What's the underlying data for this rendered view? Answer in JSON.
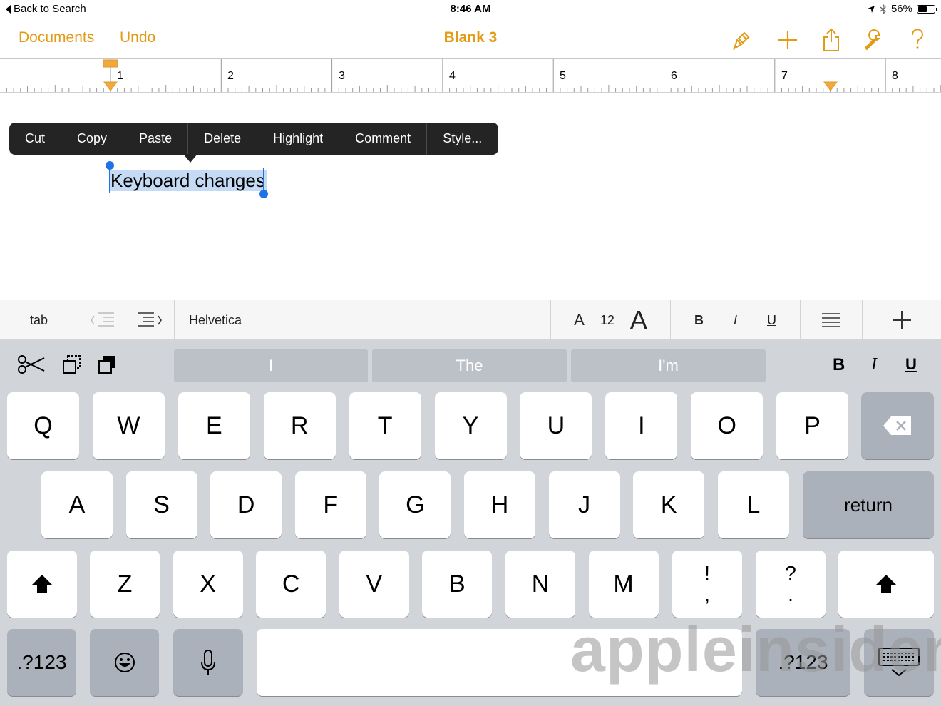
{
  "status": {
    "back_label": "Back to Search",
    "time": "8:46 AM",
    "battery_text": "56%",
    "battery_level": 0.56
  },
  "nav": {
    "documents": "Documents",
    "undo": "Undo",
    "title": "Blank 3",
    "icons": [
      "paintbrush-icon",
      "plus-icon",
      "share-icon",
      "wrench-icon",
      "help-icon"
    ]
  },
  "ruler": {
    "numbers": [
      "1",
      "2",
      "3",
      "4",
      "5",
      "6",
      "7",
      "8"
    ]
  },
  "edit_menu": {
    "items": [
      "Cut",
      "Copy",
      "Paste",
      "Delete",
      "Highlight",
      "Comment",
      "Style..."
    ]
  },
  "document": {
    "selected_text": "Keyboard changes"
  },
  "format_bar": {
    "tab": "tab",
    "font": "Helvetica",
    "font_size": "12",
    "small_a": "A",
    "large_a": "A",
    "bold": "B",
    "italic": "I",
    "underline": "U"
  },
  "keyboard": {
    "suggestions": [
      "I",
      "The",
      "I'm"
    ],
    "shortcut_bold": "B",
    "shortcut_italic": "I",
    "shortcut_underline": "U",
    "row1": [
      "Q",
      "W",
      "E",
      "R",
      "T",
      "Y",
      "U",
      "I",
      "O",
      "P"
    ],
    "row2": [
      "A",
      "S",
      "D",
      "F",
      "G",
      "H",
      "J",
      "K",
      "L"
    ],
    "row3": [
      "Z",
      "X",
      "C",
      "V",
      "B",
      "N",
      "M"
    ],
    "punct1_top": "!",
    "punct1_bottom": ",",
    "punct2_top": "?",
    "punct2_bottom": ".",
    "return_label": "return",
    "numbers_label": ".?123",
    "numbers_label_right": ".?123"
  },
  "watermark": "appleinsider"
}
